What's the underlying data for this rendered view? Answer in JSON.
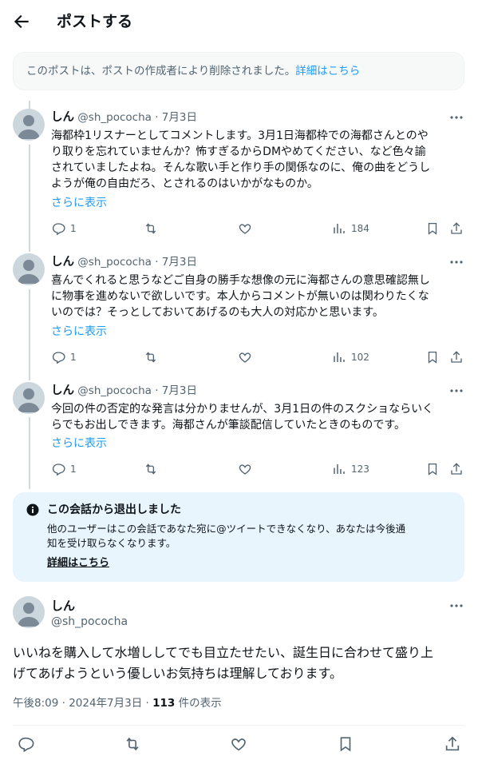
{
  "header": {
    "title": "ポストする"
  },
  "deleted_notice": {
    "text": "このポストは、ポストの作成者により削除されました。",
    "link": "詳細はこちら"
  },
  "replies": [
    {
      "name": "しん",
      "meta": "@sh_pococha · 7月3日",
      "lines": [
        "海都枠1リスナーとしてコメントします。3月1日海都枠での海都さんとのや",
        "り取りを忘れていませんか？怖すぎるからDMやめてください、など色々諭",
        "されていましたよね。そんな歌い手と作り手の関係なのに、俺の曲をどうし",
        "ようが俺の自由だろ、とされるのはいかがなものか。"
      ],
      "show_more": "さらに表示",
      "replies_count": "1",
      "views": "184"
    },
    {
      "name": "しん",
      "meta": "@sh_pococha · 7月3日",
      "lines": [
        "喜んでくれると思うなどご自身の勝手な想像の元に海都さんの意思確認無し",
        "に物事を進めないで欲しいです。本人からコメントが無いのは関わりたくな",
        "いのでは？そっとしておいてあげるのも大人の対応かと思います。"
      ],
      "show_more": "さらに表示",
      "replies_count": "1",
      "views": "102"
    },
    {
      "name": "しん",
      "meta": "@sh_pococha · 7月3日",
      "lines": [
        "今回の件の否定的な発言は分かりませんが、3月1日の件のスクショならいく",
        "らでもお出しできます。海都さんが筆談配信していたときのものです。"
      ],
      "show_more": "さらに表示",
      "replies_count": "1",
      "views": "123"
    }
  ],
  "left_notice": {
    "title": "この会話から退出しました",
    "body_line1": "他のユーザーはこの会話であなた宛に@ツイートできなくなり、あなたは今後通",
    "body_line2": "知を受け取らなくなります。",
    "link": "詳細はこちら"
  },
  "main_post": {
    "name": "しん",
    "handle": "@sh_pococha",
    "line1": "いいねを購入して水増ししてでも目立たせたい、誕生日に合わせて盛り上",
    "line2": "げてあげようという優しいお気持ちは理解しております。",
    "time": "午後8:09 · 2024年7月3日 · ",
    "views": "113",
    "views_suffix": " 件の表示"
  },
  "colors": {
    "accent": "#1d9bf0",
    "notice_bg": "#e8f5fd",
    "muted": "#536471"
  },
  "icons": [
    "back-arrow-icon",
    "more-icon",
    "reply-icon",
    "retweet-icon",
    "like-icon",
    "views-icon",
    "bookmark-icon",
    "share-icon",
    "info-icon"
  ]
}
